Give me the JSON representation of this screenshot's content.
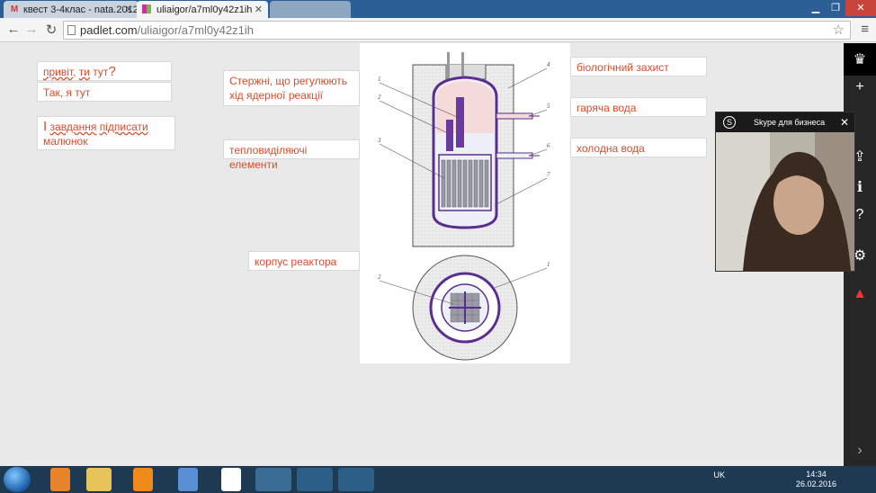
{
  "browser": {
    "tabs": [
      {
        "label": "квест 3-4клас - nata.2012",
        "icon": "gmail-icon"
      },
      {
        "label": "uliaigor/a7ml0y42z1ih",
        "icon": "padlet-icon"
      }
    ],
    "url_domain": "padlet.com",
    "url_path": "/uliaigor/a7ml0y42z1ih"
  },
  "notes": {
    "greeting_part1": "привіт",
    "greeting_part2": ", ",
    "greeting_part3": "ти",
    "greeting_part4": " тут",
    "greeting_q": "?",
    "reply": "Так, я тут",
    "task_num": "І",
    "task_text1": "завдання",
    "task_text2": " ",
    "task_text3": "підписати",
    "task_text4": "малюнок",
    "rods": "Стержні, що регулюють хід ядерної реакції",
    "fuel": "тепловиділяючі елементи",
    "vessel": "корпус реактора",
    "shield": "біологічний захист",
    "hot": "гаряча вода",
    "cold": "холодна вода"
  },
  "diagram_numbers": {
    "n1": "1",
    "n2": "2",
    "n3": "3",
    "n4": "4",
    "n5": "5",
    "n6": "6",
    "n7": "7",
    "c1": "1",
    "c2": "2"
  },
  "skype": {
    "title": "Skype для бизнеса"
  },
  "taskbar": {
    "lang": "UK",
    "time": "14:34",
    "date": "26.02.2016"
  },
  "colors": {
    "note_text": "#e04a2a",
    "reactor_purple": "#5a2d91",
    "sidebar": "#262626"
  }
}
